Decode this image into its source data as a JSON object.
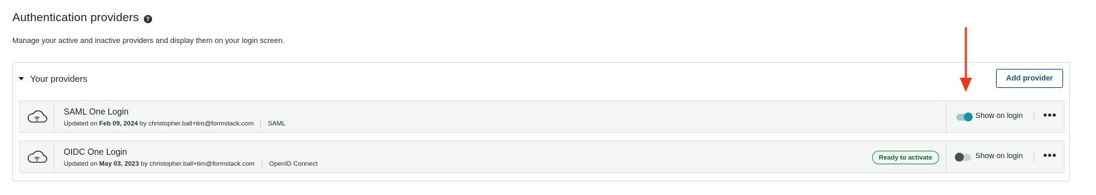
{
  "page": {
    "title": "Authentication providers",
    "help_icon": "?",
    "subtitle": "Manage your active and inactive providers and display them on your login screen."
  },
  "providers_panel": {
    "title": "Your providers",
    "add_button": "Add provider"
  },
  "providers": [
    {
      "name": "SAML One Login",
      "updated_prefix": "Updated on",
      "updated_date": "Feb 09, 2024",
      "updated_by": "by christopher.ball+tim@formstack.com",
      "type": "SAML",
      "status_badge": "",
      "show_on_login": true,
      "toggle_label": "Show on login",
      "icon": "cloud-wifi-icon"
    },
    {
      "name": "OIDC One Login",
      "updated_prefix": "Updated on",
      "updated_date": "May 03, 2023",
      "updated_by": "by christopher.ball+tim@formstack.com",
      "type": "OpenID Connect",
      "status_badge": "Ready to activate",
      "show_on_login": false,
      "toggle_label": "Show on login",
      "icon": "cloud-wifi-icon"
    }
  ],
  "more_glyph": "•••",
  "colors": {
    "toggle_on": "#1a8fa8",
    "toggle_off": "#4a4f55",
    "badge_border": "#2e8b57",
    "button_border": "#1f4e79",
    "annotation_arrow": "#e8391f"
  }
}
